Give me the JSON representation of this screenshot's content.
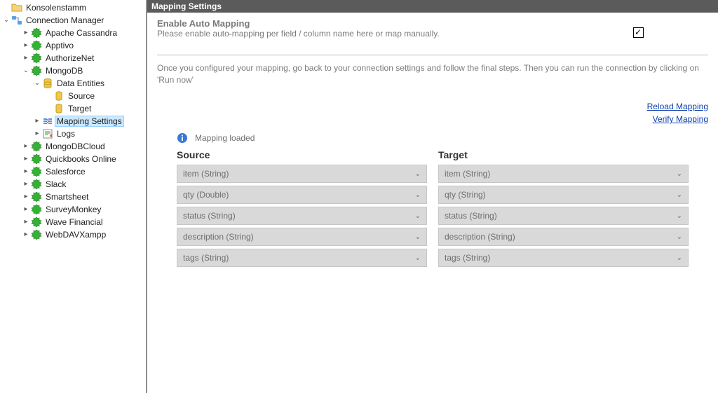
{
  "tree": {
    "root": "Konsolenstamm",
    "cm": "Connection Manager",
    "items": [
      "Apache Cassandra",
      "Apptivo",
      "AuthorizeNet",
      "MongoDB",
      "MongoDBCloud",
      "Quickbooks Online",
      "Salesforce",
      "Slack",
      "Smartsheet",
      "SurveyMonkey",
      "Wave Financial",
      "WebDAVXampp"
    ],
    "mongo": {
      "de": "Data Entities",
      "src": "Source",
      "tgt": "Target",
      "map": "Mapping Settings",
      "logs": "Logs"
    }
  },
  "panel": {
    "title": "Mapping Settings",
    "enable_heading": "Enable Auto Mapping",
    "enable_desc": "Please enable auto-mapping per field / column name here or map manually.",
    "instructions": "Once you configured your mapping, go back to your connection settings and follow the final steps. Then you can run the connection by clicking on 'Run now'",
    "reload": "Reload Mapping",
    "verify": "Verify Mapping",
    "status": "Mapping loaded",
    "source_head": "Source",
    "target_head": "Target",
    "rows": [
      {
        "src": "item (String)",
        "tgt": "item (String)"
      },
      {
        "src": "qty (Double)",
        "tgt": "qty (String)"
      },
      {
        "src": "status (String)",
        "tgt": "status (String)"
      },
      {
        "src": "description (String)",
        "tgt": "description (String)"
      },
      {
        "src": "tags (String)",
        "tgt": "tags (String)"
      }
    ]
  }
}
